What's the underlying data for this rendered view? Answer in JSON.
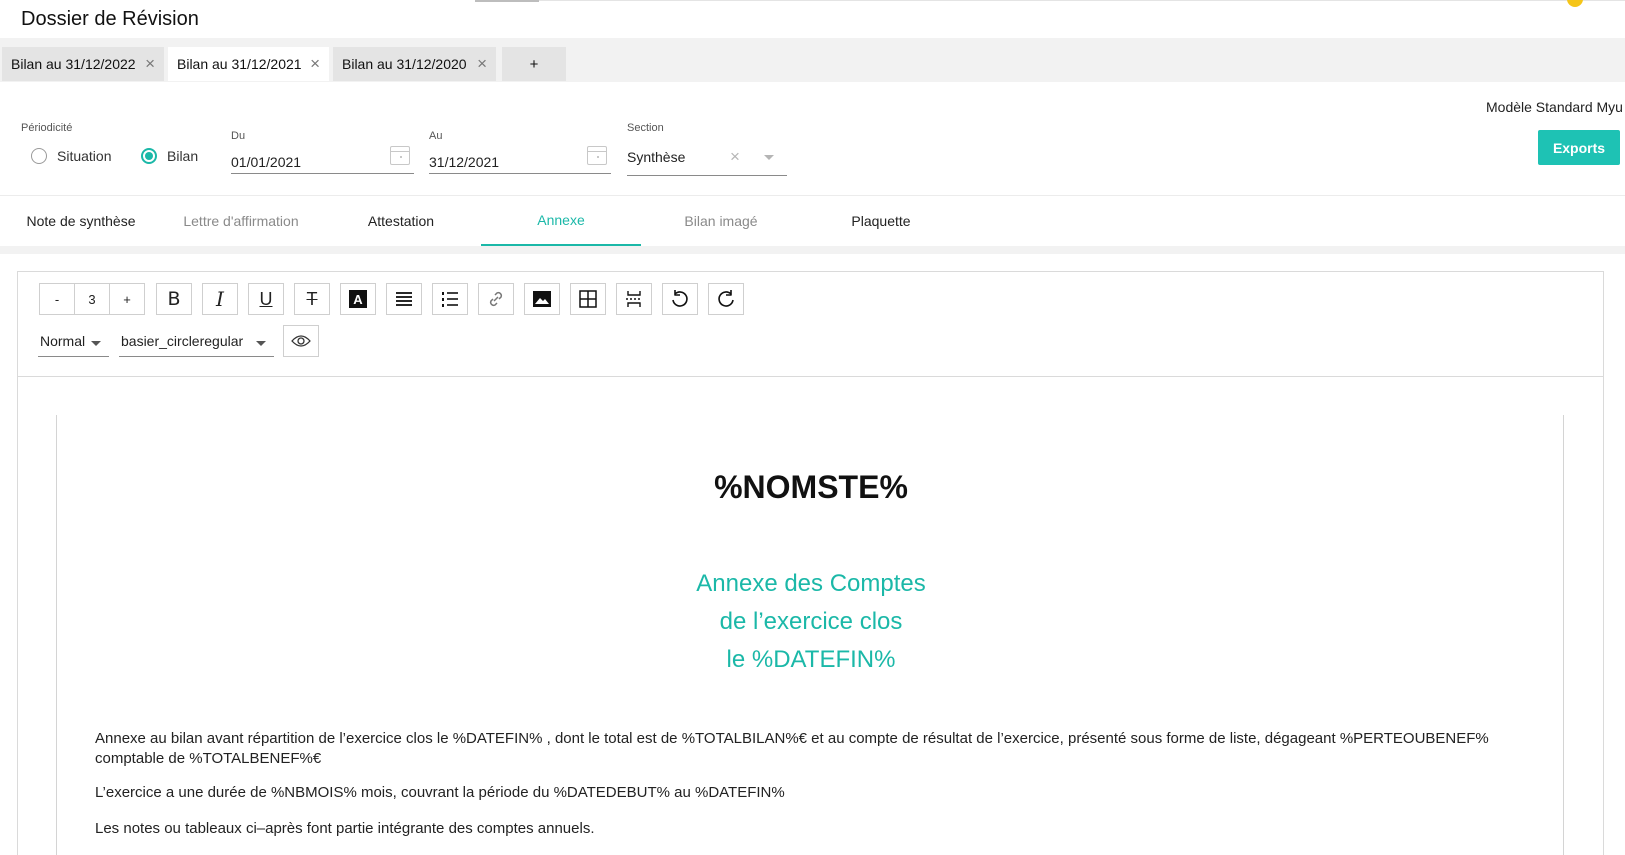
{
  "app": {
    "title": "Dossier de Révision"
  },
  "file_tabs": [
    {
      "label": "Bilan au 31/12/2022",
      "closable": true,
      "active": false
    },
    {
      "label": "Bilan au 31/12/2021",
      "closable": true,
      "active": true
    },
    {
      "label": "Bilan au 31/12/2020",
      "closable": true,
      "active": false
    },
    {
      "label": "+"
    }
  ],
  "filters": {
    "periodicite_label": "Périodicité",
    "options": [
      "Situation",
      "Bilan"
    ],
    "selected": "Bilan",
    "du_label": "Du",
    "du_value": "01/01/2021",
    "au_label": "Au",
    "au_value": "31/12/2021",
    "section_label": "Section",
    "section_value": "Synthèse",
    "model_name": "Modèle Standard Myu",
    "exports_label": "Exports"
  },
  "nav_tabs": [
    {
      "label": "Note de synthèse",
      "state": "normal"
    },
    {
      "label": "Lettre d'affirmation",
      "state": "muted"
    },
    {
      "label": "Attestation",
      "state": "normal"
    },
    {
      "label": "Annexe",
      "state": "active"
    },
    {
      "label": "Bilan imagé",
      "state": "muted"
    },
    {
      "label": "Plaquette",
      "state": "normal"
    }
  ],
  "toolbar": {
    "font_size_decrease": "-",
    "font_size_value": "3",
    "font_size_increase": "+",
    "icons": [
      "bold-icon",
      "italic-icon",
      "underline-icon",
      "strikethrough-icon",
      "text-color-icon",
      "align-justify-icon",
      "numbered-list-icon",
      "link-icon",
      "image-icon",
      "table-icon",
      "page-break-icon",
      "undo-icon",
      "redo-icon",
      "preview-eye-icon"
    ],
    "bold_glyph": "B",
    "italic_glyph": "I",
    "underline_glyph": "U",
    "strike_glyph": "T",
    "color_glyph": "A",
    "paragraph_style": "Normal",
    "font_family": "basier_circleregular"
  },
  "document": {
    "title": "%NOMSTE%",
    "subtitle_lines": [
      "Annexe des Comptes",
      "de l’exercice clos",
      "le %DATEFIN%"
    ],
    "paragraphs": [
      "Annexe au bilan avant répartition de l’exercice clos le %DATEFIN% , dont le total est de %TOTALBILAN%€ et au compte de résultat de l’exercice, présenté sous forme de liste, dégageant %PERTEOUBENEF% comptable de %TOTALBENEF%€",
      "L’exercice a une durée de %NBMOIS% mois, couvrant la période du %DATEDEBUT% au %DATEFIN%",
      "Les notes ou tableaux ci–après font partie intégrante des comptes annuels."
    ]
  },
  "colors": {
    "accent": "#1bb8a8",
    "exports_button": "#1ec2b4",
    "status_dot": "#f5c518"
  }
}
